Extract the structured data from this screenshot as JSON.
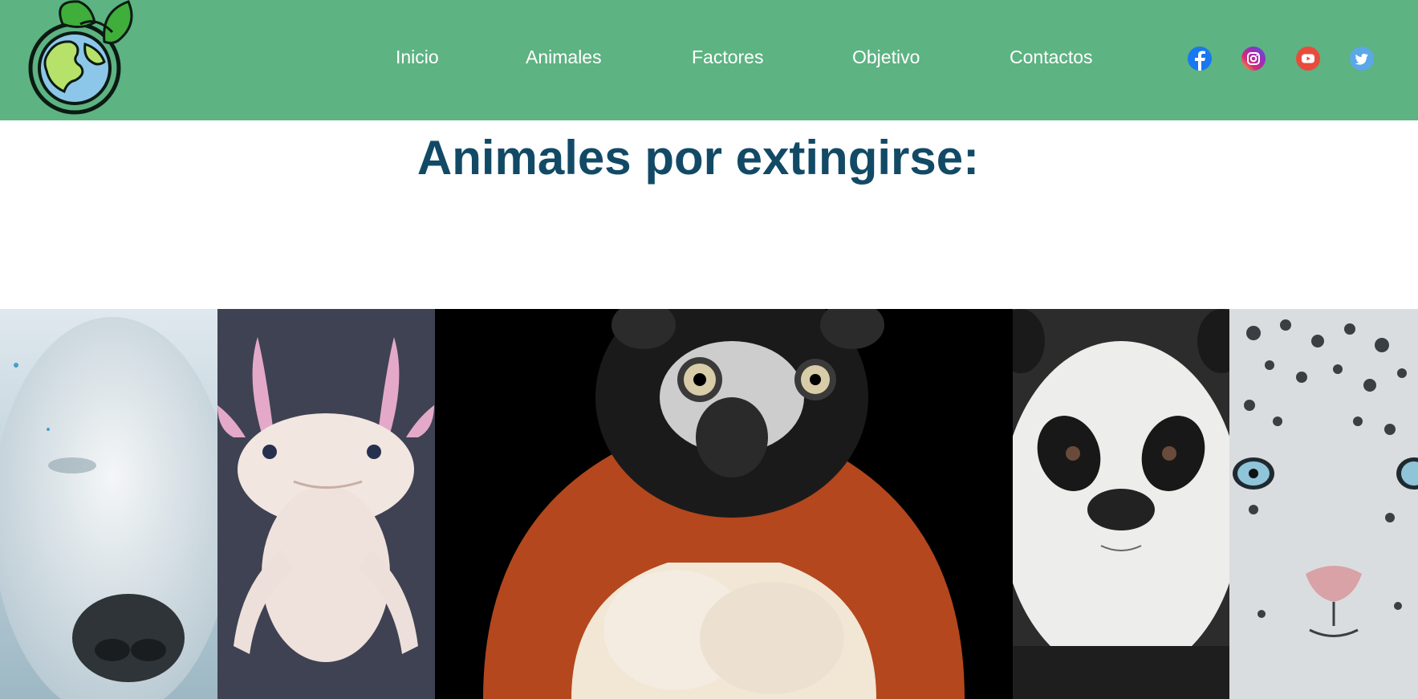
{
  "header": {
    "background_color": "#5db382",
    "logo": {
      "icon": "globe-with-leaves-icon"
    },
    "nav": [
      {
        "label": "Inicio"
      },
      {
        "label": "Animales"
      },
      {
        "label": "Factores"
      },
      {
        "label": "Objetivo"
      },
      {
        "label": "Contactos"
      }
    ],
    "social": [
      {
        "icon": "facebook-icon",
        "color": "#1877f2"
      },
      {
        "icon": "instagram-icon",
        "color": "#d62976"
      },
      {
        "icon": "youtube-icon",
        "color": "#e84b3c"
      },
      {
        "icon": "twitter-icon",
        "color": "#5aa8e8"
      }
    ]
  },
  "main": {
    "title": "Animales por extingirse:",
    "title_color": "#124a66",
    "gallery": [
      {
        "subject": "polar-bear-photo"
      },
      {
        "subject": "axolotl-photo"
      },
      {
        "subject": "lemur-photo"
      },
      {
        "subject": "panda-photo"
      },
      {
        "subject": "snow-leopard-photo"
      }
    ]
  }
}
